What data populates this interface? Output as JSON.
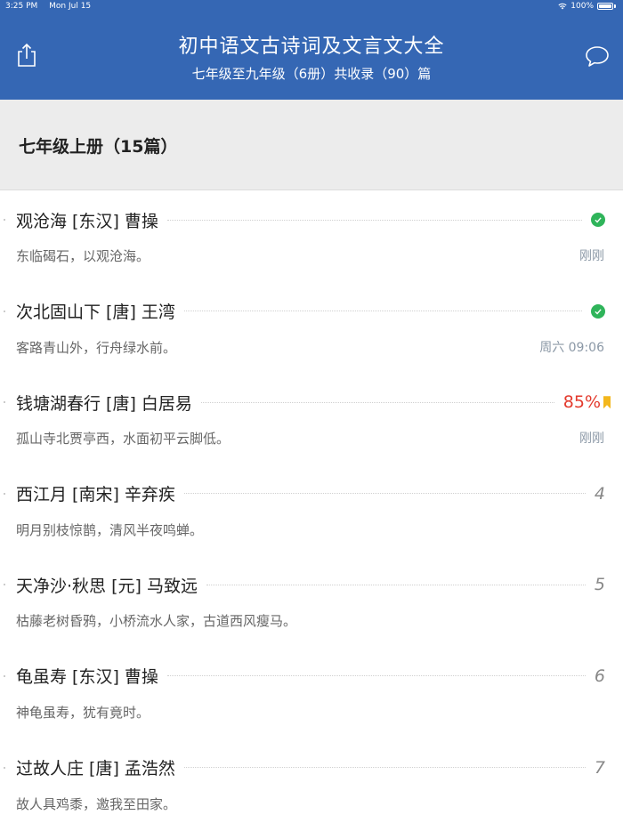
{
  "status_bar": {
    "time": "3:25 PM",
    "date": "Mon Jul 15",
    "battery": "100%"
  },
  "header": {
    "title": "初中语文古诗词及文言文大全",
    "subtitle": "七年级至九年级（6册）共收录（90）篇",
    "share_icon": "share-icon",
    "chat_icon": "chat-bubble-icon",
    "bg_color": "#3567b4"
  },
  "section": {
    "title": "七年级上册（15篇）"
  },
  "items": [
    {
      "title": "观沧海  [东汉] 曹操",
      "excerpt": "东临碣石，以观沧海。",
      "time": "刚刚",
      "status": "done"
    },
    {
      "title": "次北固山下  [唐] 王湾",
      "excerpt": "客路青山外，行舟绿水前。",
      "time": "周六 09:06",
      "status": "done"
    },
    {
      "title": "钱塘湖春行  [唐] 白居易",
      "excerpt": "孤山寺北贾亭西，水面初平云脚低。",
      "time": "刚刚",
      "status": "progress",
      "percent": "85%"
    },
    {
      "title": "西江月  [南宋] 辛弃疾",
      "excerpt": "明月别枝惊鹊，清风半夜鸣蝉。",
      "time": "",
      "status": "number",
      "number": "4"
    },
    {
      "title": "天净沙·秋思  [元] 马致远",
      "excerpt": "枯藤老树昏鸦，小桥流水人家，古道西风瘦马。",
      "time": "",
      "status": "number",
      "number": "5"
    },
    {
      "title": "龟虽寿  [东汉] 曹操",
      "excerpt": "神龟虽寿，犹有竟时。",
      "time": "",
      "status": "number",
      "number": "6"
    },
    {
      "title": "过故人庄  [唐] 孟浩然",
      "excerpt": "故人具鸡黍，邀我至田家。",
      "time": "",
      "status": "number",
      "number": "7"
    }
  ],
  "colors": {
    "check": "#2fb45a",
    "percent": "#e33a2d",
    "bookmark": "#f3b71d"
  }
}
